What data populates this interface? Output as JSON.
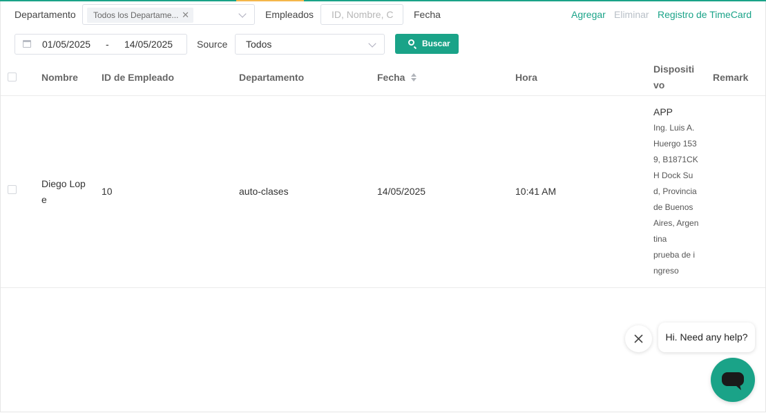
{
  "filters": {
    "department_label": "Departamento",
    "department_tag": "Todos los Departame...",
    "employees_label": "Empleados",
    "employees_placeholder": "ID, Nombre, C",
    "date_label": "Fecha",
    "date_start": "01/05/2025",
    "date_separator": "-",
    "date_end": "14/05/2025",
    "source_label": "Source",
    "source_value": "Todos",
    "search_button": "Buscar"
  },
  "actions": {
    "add": "Agregar",
    "delete": "Eliminar",
    "timecard_log": "Registro de TimeCard"
  },
  "table": {
    "columns": {
      "name": "Nombre",
      "employee_id": "ID de Empleado",
      "department": "Departamento",
      "date": "Fecha",
      "time": "Hora",
      "device_line1": "Dispositi",
      "device_line2": "vo",
      "remark": "Remark"
    },
    "rows": [
      {
        "name_line1": "Diego Lop",
        "name_line2": "e",
        "employee_id": "10",
        "department": "auto-clases",
        "date": "14/05/2025",
        "time": "10:41 AM",
        "device": "APP",
        "address_lines": [
          "Ing. Luis A.",
          "Huergo 153",
          "9, B1871CK",
          "H Dock Su",
          "d, Provincia",
          "de Buenos",
          "Aires, Argen",
          "tina"
        ],
        "note_lines": [
          "prueba de i",
          "ngreso"
        ],
        "remark": ""
      }
    ]
  },
  "help": {
    "message": "Hi. Need any help?"
  },
  "colors": {
    "accent": "#1aa388",
    "disabled_link": "#b8bfc7"
  }
}
